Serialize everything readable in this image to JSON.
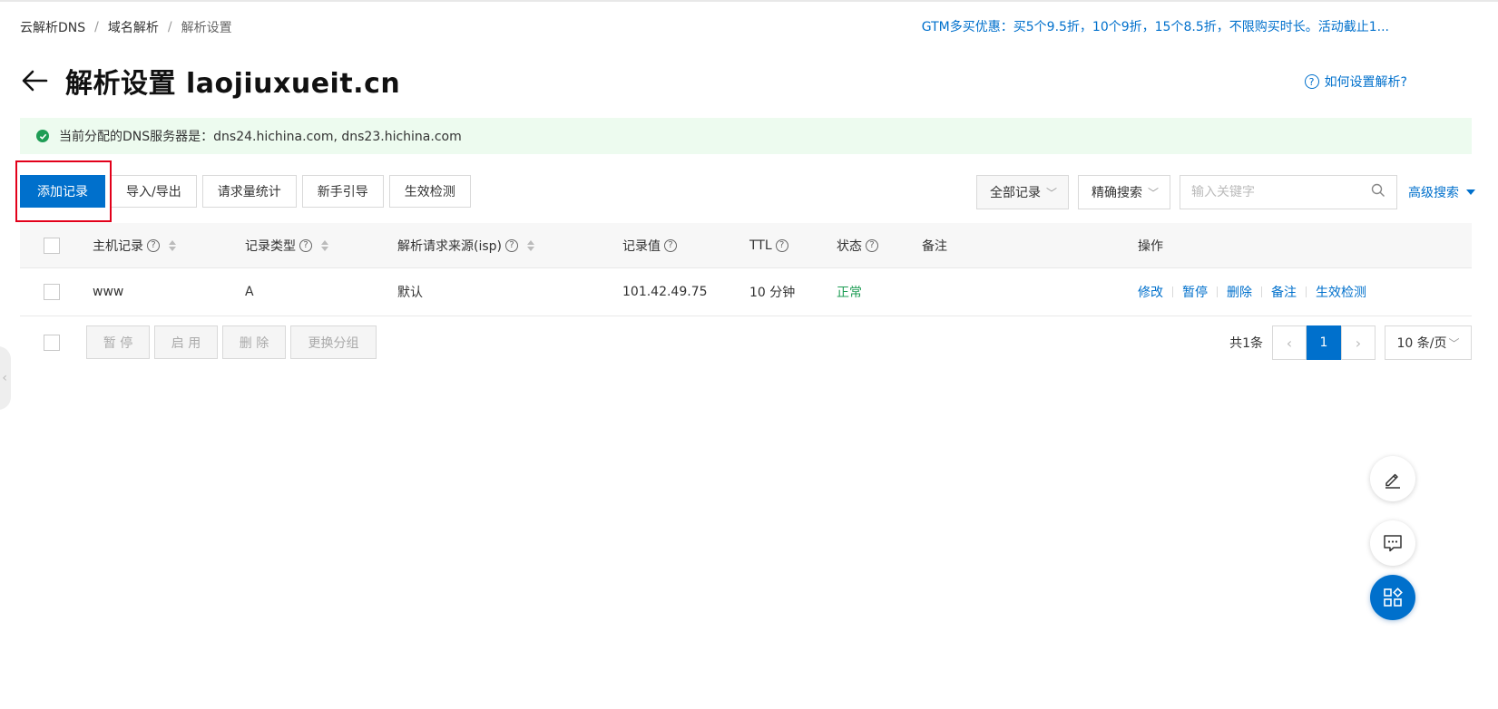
{
  "breadcrumb": {
    "items": [
      "云解析DNS",
      "域名解析",
      "解析设置"
    ],
    "separator": "/"
  },
  "promo": {
    "text": "GTM多买优惠：买5个9.5折，10个9折，15个8.5折，不限购买时长。活动截止1..."
  },
  "header": {
    "title": "解析设置 laojiuxueit.cn",
    "help_link": "如何设置解析?"
  },
  "alert": {
    "text": "当前分配的DNS服务器是：dns24.hichina.com, dns23.hichina.com"
  },
  "toolbar": {
    "add_record": "添加记录",
    "import_export": "导入/导出",
    "request_stats": "请求量统计",
    "beginner_guide": "新手引导",
    "effect_check": "生效检测"
  },
  "filters": {
    "record_scope": "全部记录",
    "search_mode": "精确搜索",
    "search_placeholder": "输入关键字",
    "advanced_search": "高级搜索"
  },
  "table": {
    "columns": {
      "host": "主机记录",
      "type": "记录类型",
      "isp": "解析请求来源(isp)",
      "value": "记录值",
      "ttl": "TTL",
      "status": "状态",
      "remark": "备注",
      "actions": "操作"
    },
    "rows": [
      {
        "host": "www",
        "type": "A",
        "isp": "默认",
        "value": "101.42.49.75",
        "ttl": "10 分钟",
        "status": "正常",
        "remark": "",
        "actions": [
          "修改",
          "暂停",
          "删除",
          "备注",
          "生效检测"
        ]
      }
    ]
  },
  "bulk_actions": {
    "pause": "暂 停",
    "enable": "启 用",
    "delete": "删 除",
    "change_group": "更换分组"
  },
  "pagination": {
    "total": "共1条",
    "current_page": "1",
    "page_size": "10 条/页"
  },
  "colors": {
    "primary": "#0070cc",
    "success": "#1f9d55",
    "alert_bg": "#edfbef",
    "highlight": "#e2001a"
  }
}
